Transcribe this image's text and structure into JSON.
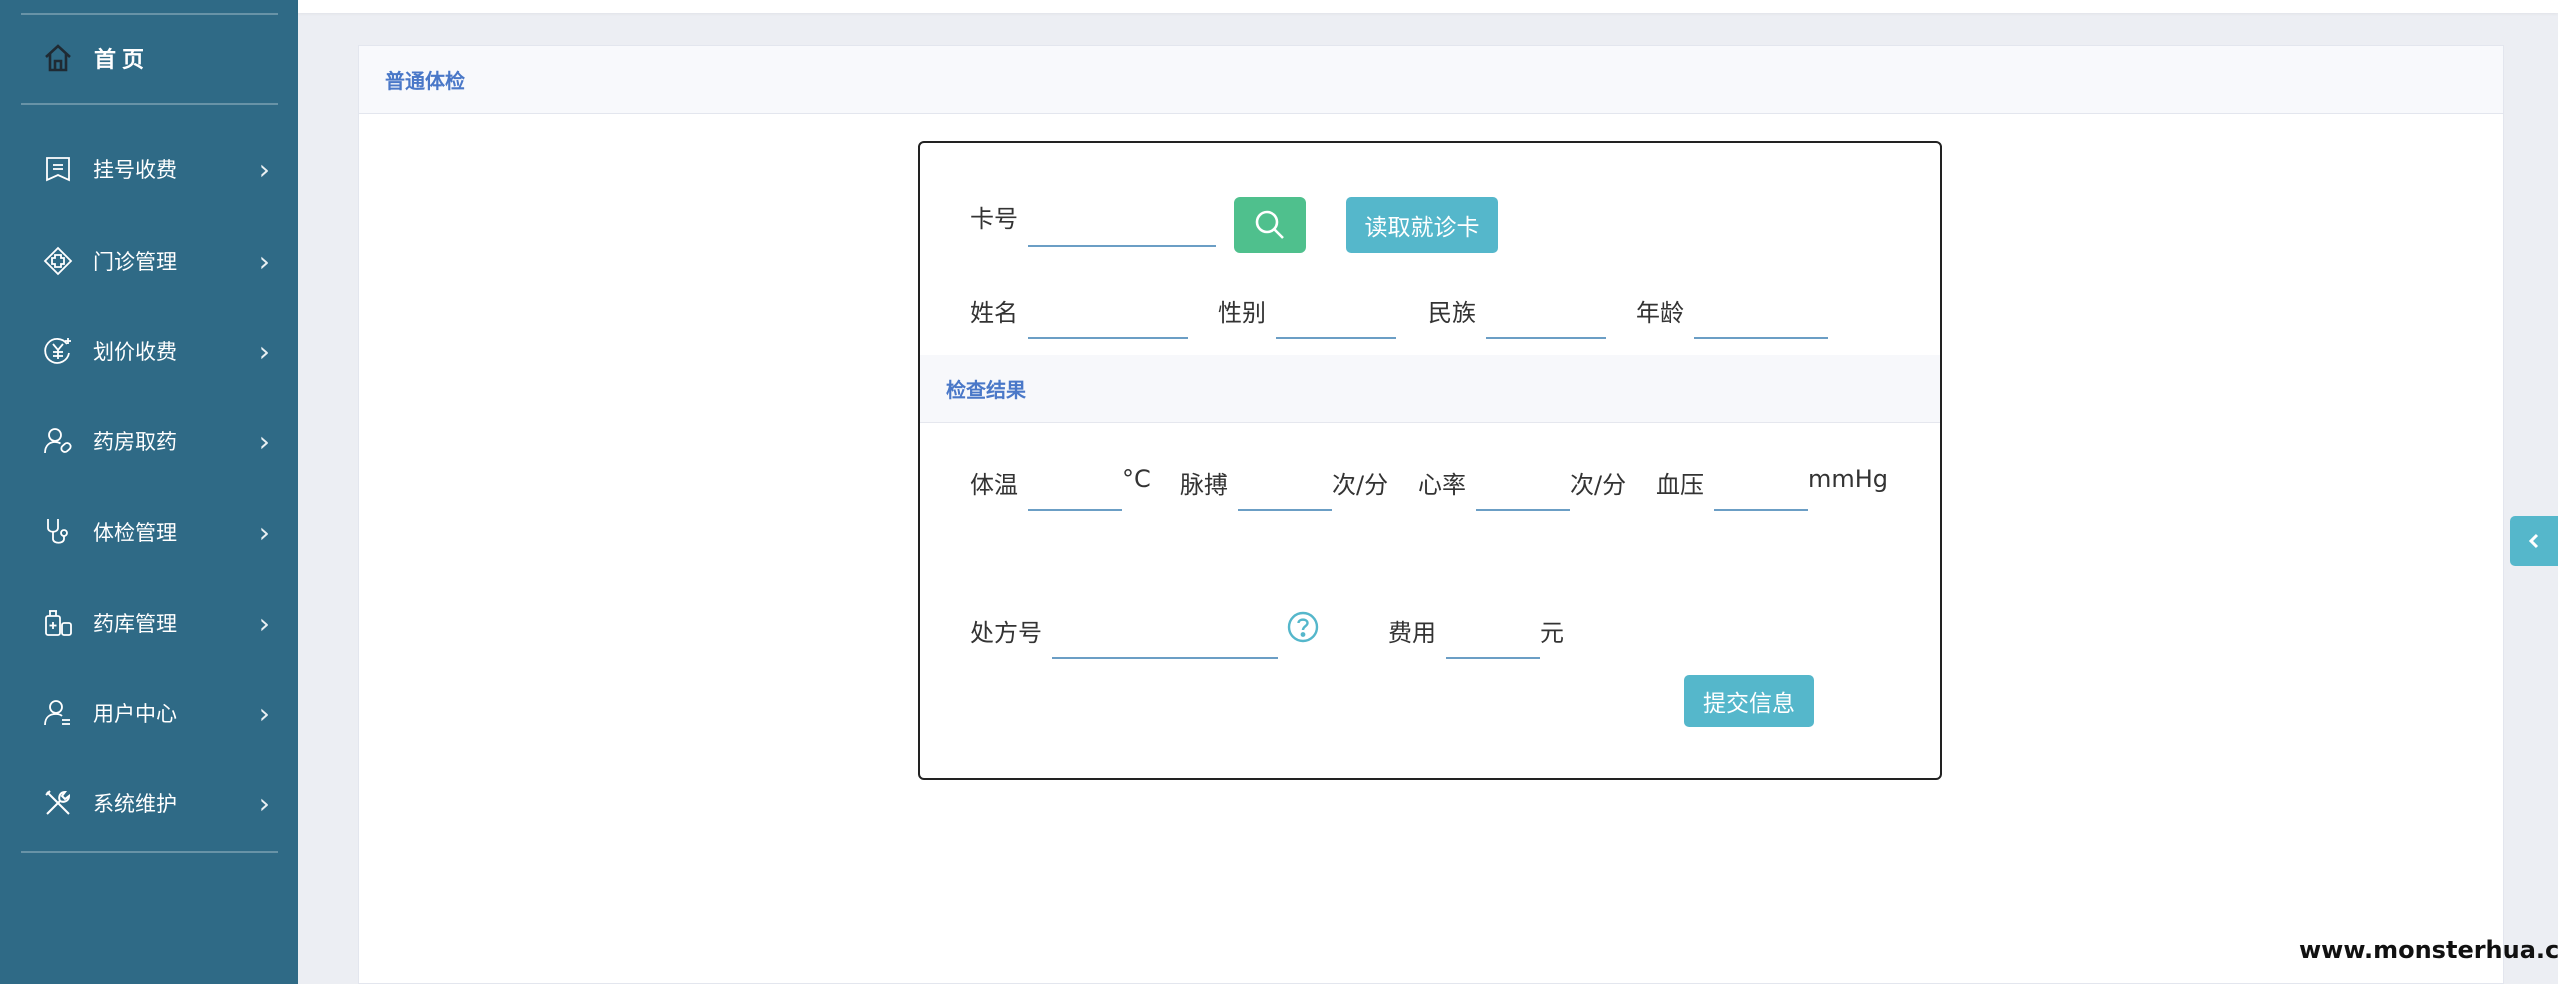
{
  "sidebar": {
    "home_label": "首页",
    "items": [
      {
        "label": "挂号收费",
        "icon": "register-icon"
      },
      {
        "label": "门诊管理",
        "icon": "clinic-icon"
      },
      {
        "label": "划价收费",
        "icon": "yuan-icon"
      },
      {
        "label": "药房取药",
        "icon": "pharmacy-icon"
      },
      {
        "label": "体检管理",
        "icon": "stethoscope-icon"
      },
      {
        "label": "药库管理",
        "icon": "medicine-store-icon"
      },
      {
        "label": "用户中心",
        "icon": "user-icon"
      },
      {
        "label": "系统维护",
        "icon": "tools-icon"
      }
    ]
  },
  "panel": {
    "title": "普通体检"
  },
  "form": {
    "card_label": "卡号",
    "card_value": "",
    "read_card_button": "读取就诊卡",
    "name_label": "姓名",
    "gender_label": "性别",
    "ethnicity_label": "民族",
    "age_label": "年龄",
    "section_title": "检查结果",
    "temperature_label": "体温",
    "temperature_unit": "°C",
    "pulse_label": "脉搏",
    "pulse_unit": "次/分",
    "heart_rate_label": "心率",
    "heart_rate_unit": "次/分",
    "blood_pressure_label": "血压",
    "blood_pressure_unit": "mmHg",
    "prescription_label": "处方号",
    "fee_label": "费用",
    "fee_unit": "元",
    "submit_button": "提交信息"
  },
  "watermark": "www.monsterhua.com",
  "colors": {
    "sidebar": "#2f6a86",
    "accent": "#55b7cb",
    "search": "#4fc08d",
    "title": "#4a78c8"
  }
}
